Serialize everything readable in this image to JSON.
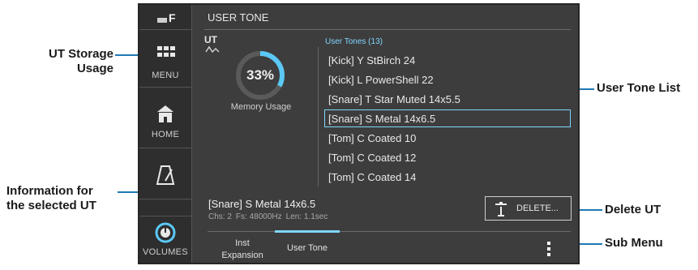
{
  "callouts": {
    "storage": "UT Storage\nUsage",
    "info": "Information for\nthe selected UT",
    "list": "User Tone List",
    "delete": "Delete UT",
    "submenu": "Sub Menu"
  },
  "sidebar": {
    "menu_label": "MENU",
    "home_label": "HOME",
    "volumes_label": "VOLUMES"
  },
  "screen": {
    "title": "USER TONE",
    "memory": {
      "badge": "UT",
      "percent_label": "33%",
      "percent": 33,
      "caption": "Memory Usage",
      "accent_color": "#5bc8f5"
    },
    "list_title": "User Tones (13)",
    "tones": [
      "[Kick] Y StBirch 24",
      "[Kick] L PowerShell 22",
      "[Snare] T Star Muted 14x5.5",
      "[Snare] S Metal 14x6.5",
      "[Tom] C Coated 10",
      "[Tom] C Coated 12",
      "[Tom] C Coated 14"
    ],
    "selected_index": 3,
    "selected": {
      "name": "[Snare] S Metal 14x6.5",
      "chs": "Chs: 2",
      "fs": "Fs: 48000Hz",
      "len": "Len: 1.1sec"
    },
    "delete_label": "DELETE...",
    "tabs": [
      "Inst\nExpansion",
      "User Tone"
    ],
    "active_tab": 1
  }
}
